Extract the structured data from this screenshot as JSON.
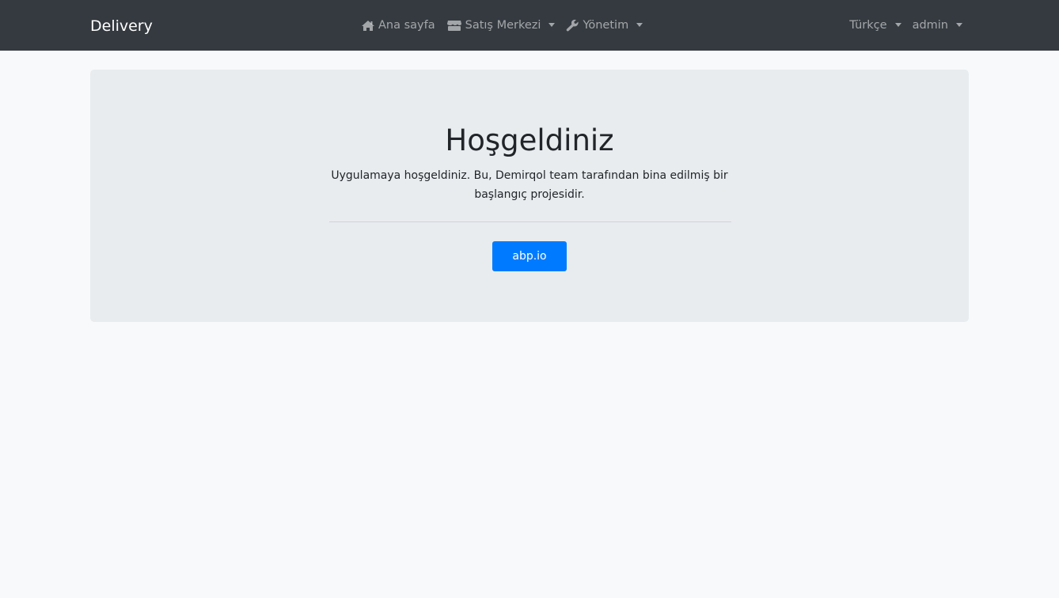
{
  "navbar": {
    "brand": "Delivery",
    "menu": [
      {
        "label": "Ana sayfa",
        "icon": "home-icon",
        "dropdown": false
      },
      {
        "label": "Satış Merkezi",
        "icon": "store-icon",
        "dropdown": true
      },
      {
        "label": "Yönetim",
        "icon": "wrench-icon",
        "dropdown": true
      }
    ],
    "language": "Türkçe",
    "user": "admin"
  },
  "hero": {
    "title": "Hoşgeldiniz",
    "text": "Uygulamaya hoşgeldiniz. Bu, Demirqol team tarafından bina edilmiş bir başlangıç projesidir.",
    "button_label": "abp.io"
  },
  "colors": {
    "navbar_bg": "#343a40",
    "page_bg": "#f8f9fa",
    "jumbotron_bg": "#e9ecef",
    "primary": "#007bff"
  }
}
